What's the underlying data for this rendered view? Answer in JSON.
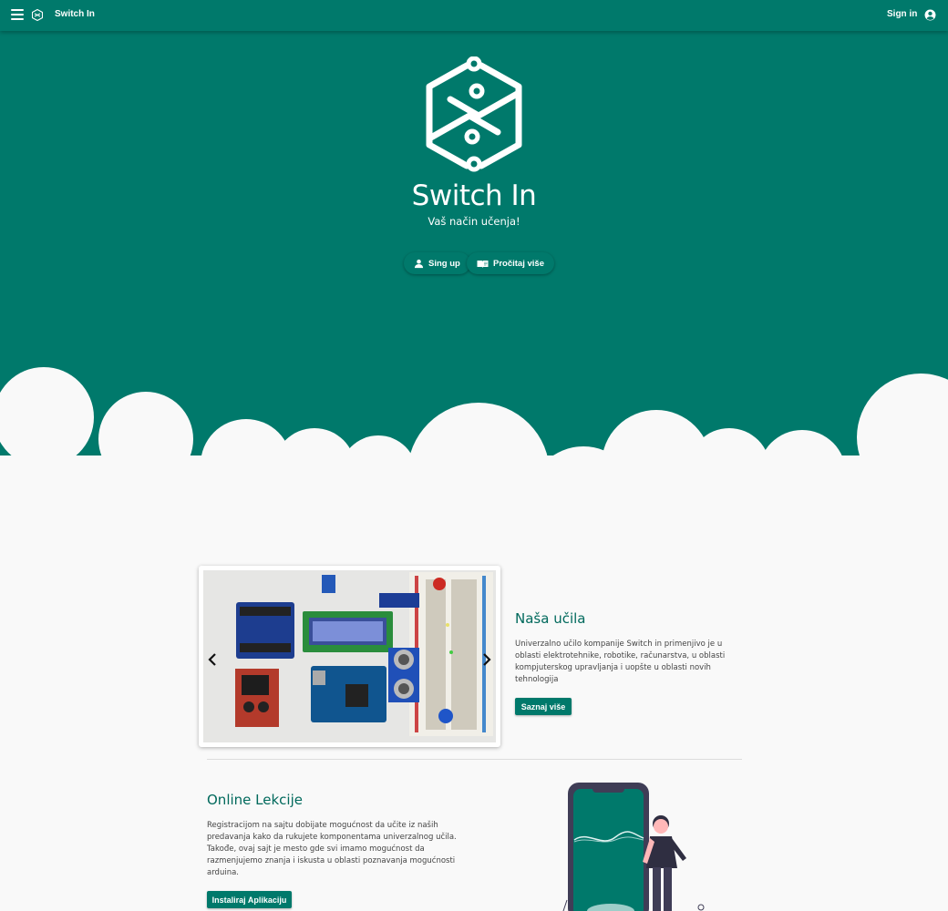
{
  "appbar": {
    "menu_icon": "menu-icon",
    "logo_icon": "switch-in-logo-icon",
    "title": "Switch In",
    "signin_label": "Sign in",
    "account_icon": "account-circle-icon"
  },
  "hero": {
    "logo_icon": "switch-in-hexagon-logo",
    "brand": "Switch In",
    "tagline": "Vaš način učenja!",
    "buttons": [
      {
        "label": "Sing up",
        "icon": "person-icon"
      },
      {
        "label": "Pročitaj više",
        "icon": "book-icon"
      }
    ],
    "background_color": "#00796b"
  },
  "section_tools": {
    "title": "Naša učila",
    "text": "Univerzalno učilo kompanije Switch in primenjivo je u oblasti elektrotehnike, robotike, računarstva, u oblasti kompjuterskog upravljanja i uopšte u oblasti novih tehnologija",
    "button_label": "Saznaj više",
    "carousel": {
      "prev_icon": "chevron-left-icon",
      "next_icon": "chevron-right-icon"
    }
  },
  "section_lessons": {
    "title": "Online Lekcije",
    "text": "Registracijom na sajtu dobijate mogućnost da učite iz naših predavanja kako da rukujete komponentama univerzalnog učila. Takođe, ovaj sajt je mesto gde svi imamo mogućnost da razmenjujemo znanja i iskusta u oblasti poznavanja mogućnosti arduina.",
    "button_label": "Instaliraj Aplikaciju"
  },
  "colors": {
    "primary": "#00796b",
    "title_accent": "#00695c",
    "background": "#f9f9f9"
  }
}
